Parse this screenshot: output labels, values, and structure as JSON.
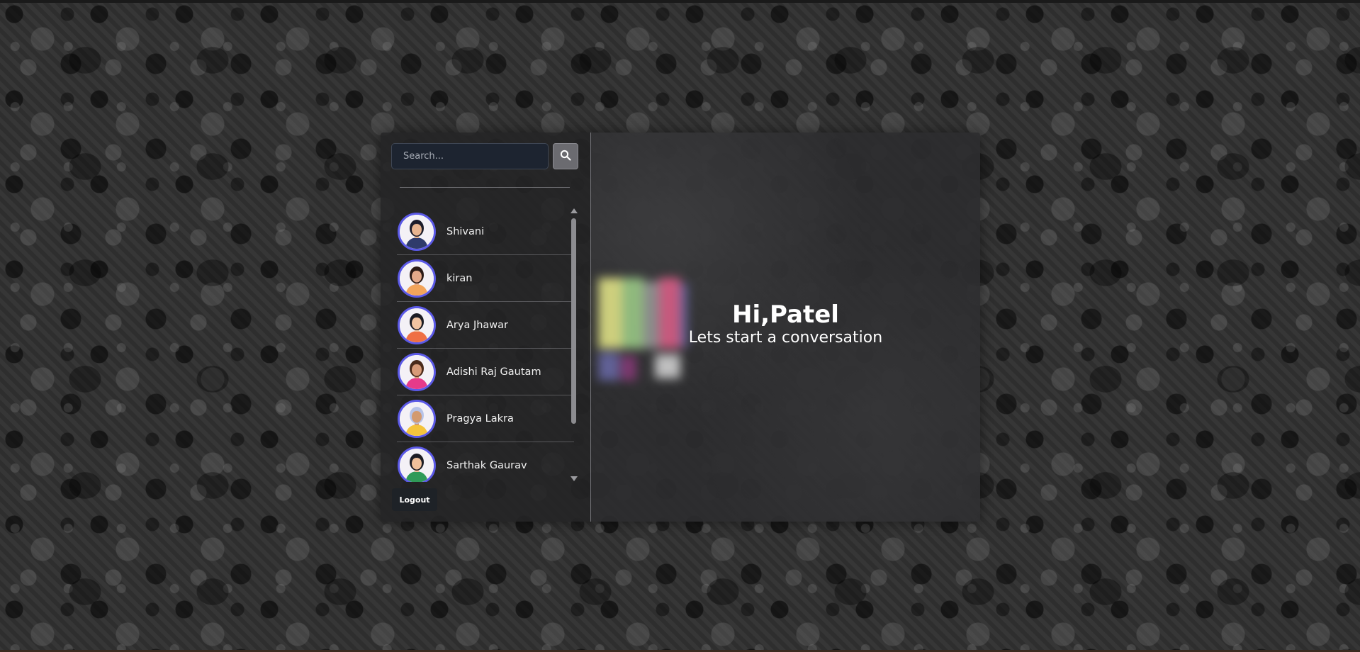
{
  "search": {
    "placeholder": "Search...",
    "value": ""
  },
  "users": [
    {
      "name": "Shivani",
      "avatar_color": "#2f3b6b",
      "skin": "#e8b48f",
      "hair": "#1c1c2a"
    },
    {
      "name": "kiran",
      "avatar_color": "#f2a45a",
      "skin": "#e4a98a",
      "hair": "#2b1a16"
    },
    {
      "name": "Arya Jhawar",
      "avatar_color": "#ef6f45",
      "skin": "#f1c3a1",
      "hair": "#1c1c24"
    },
    {
      "name": "Adishi Raj Gautam",
      "avatar_color": "#e63a8a",
      "skin": "#d89a78",
      "hair": "#4a2a1a"
    },
    {
      "name": "Pragya Lakra",
      "avatar_color": "#f4c43c",
      "skin": "#d39a70",
      "hair": "#b7c3e8"
    },
    {
      "name": "Sarthak Gaurav",
      "avatar_color": "#2f9a58",
      "skin": "#f0c09b",
      "hair": "#1c1c24"
    }
  ],
  "logout_label": "Logout",
  "welcome": {
    "title": "Hi,Patel",
    "subtitle": "Lets start a conversation"
  },
  "colors": {
    "avatar_border": "#5b59e6",
    "search_bg": "#1d2430",
    "logout_bg": "#1e2227"
  },
  "icons": {
    "search_button": "search-icon"
  }
}
